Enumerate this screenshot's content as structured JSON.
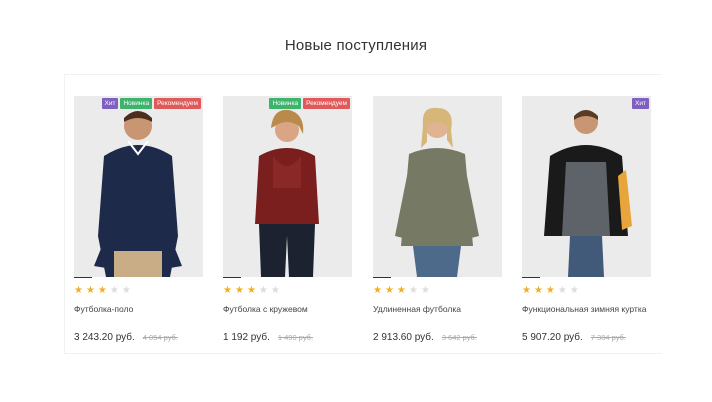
{
  "section_title": "Новые поступления",
  "colors": {
    "hit": "#7f5fc0",
    "new": "#3db36b",
    "recommended": "#e05a5a",
    "star": "#f2b01e"
  },
  "products": [
    {
      "name": "Футболка-поло",
      "price": "3 243.20 руб.",
      "old_price": "4 054 руб.",
      "rating": 3,
      "badges": [
        "Хит",
        "Новинка",
        "Рекомендуем"
      ]
    },
    {
      "name": "Футболка с кружевом",
      "price": "1 192 руб.",
      "old_price": "1 490 руб.",
      "rating": 3,
      "badges": [
        "Новинка",
        "Рекомендуем"
      ]
    },
    {
      "name": "Удлиненная футболка",
      "price": "2 913.60 руб.",
      "old_price": "3 642 руб.",
      "rating": 3,
      "badges": []
    },
    {
      "name": "Функциональная зимняя куртка",
      "price": "5 907.20 руб.",
      "old_price": "7 384 руб.",
      "rating": 3,
      "badges": [
        "Хит"
      ]
    }
  ]
}
